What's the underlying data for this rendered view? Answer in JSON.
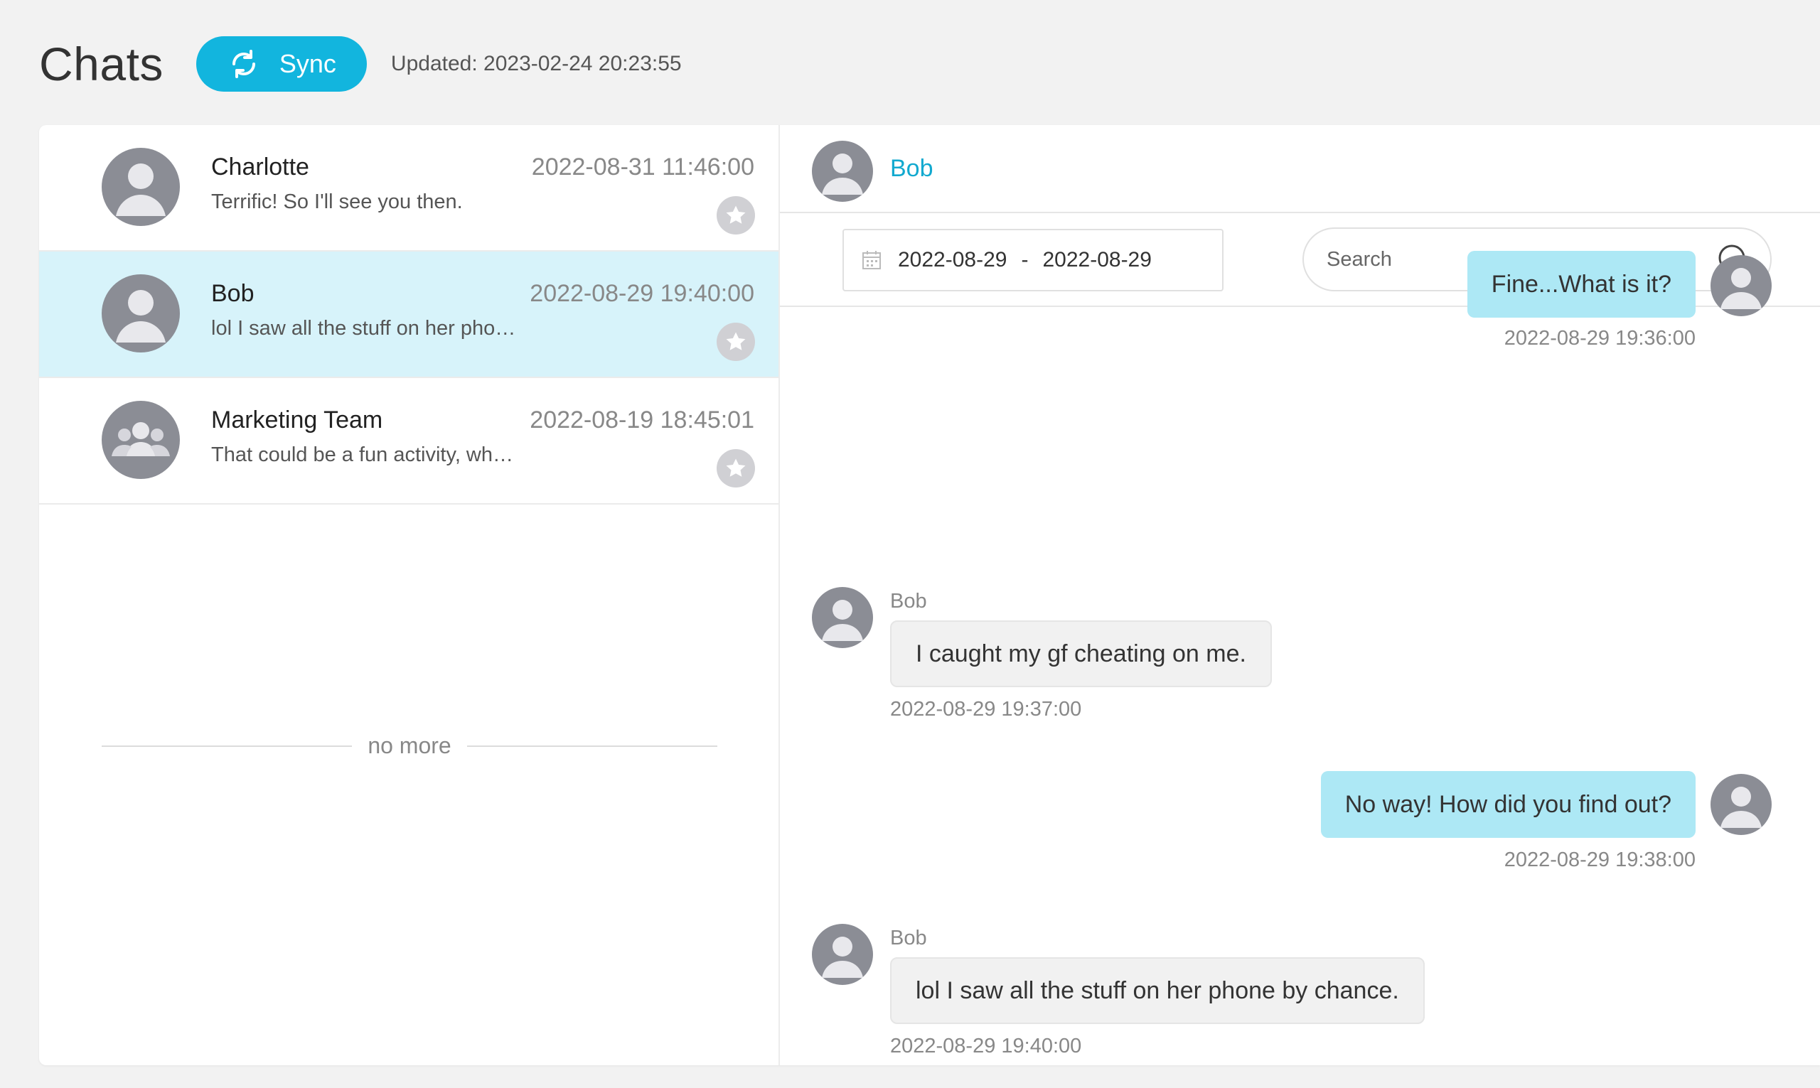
{
  "header": {
    "title": "Chats",
    "sync_label": "Sync",
    "updated": "Updated: 2023-02-24 20:23:55"
  },
  "conversations": [
    {
      "name": "Charlotte",
      "time": "2022-08-31 11:46:00",
      "preview": "Terrific! So I'll see you then.",
      "avatar": "person-avatar-icon",
      "active": false
    },
    {
      "name": "Bob",
      "time": "2022-08-29 19:40:00",
      "preview": "lol I saw all the stuff on her phone by chance.",
      "avatar": "person-avatar-icon",
      "active": true
    },
    {
      "name": "Marketing Team",
      "time": "2022-08-19 18:45:01",
      "preview": "That could be a fun activity, what do you think?",
      "avatar": "group-avatar-icon",
      "active": false
    }
  ],
  "list_footer": "no more",
  "chat": {
    "contact_name": "Bob",
    "date_start": "2022-08-29",
    "date_sep": "-",
    "date_end": "2022-08-29",
    "search_placeholder": "Search",
    "messages": [
      {
        "direction": "out",
        "text": "Fine...What is it?",
        "time": "2022-08-29 19:36:00"
      },
      {
        "direction": "in",
        "sender": "Bob",
        "text": "I caught my gf cheating on me.",
        "time": "2022-08-29 19:37:00"
      },
      {
        "direction": "out",
        "text": "No way! How did you find out?",
        "time": "2022-08-29 19:38:00"
      },
      {
        "direction": "in",
        "sender": "Bob",
        "text": "lol I saw all the stuff on her phone by chance.",
        "time": "2022-08-29 19:40:00"
      }
    ]
  },
  "colors": {
    "accent": "#12b5de",
    "active_row": "#d7f3fa",
    "outgoing_bubble": "#ade8f5",
    "incoming_bubble": "#f1f1f1",
    "avatar": "#8b8d95"
  }
}
